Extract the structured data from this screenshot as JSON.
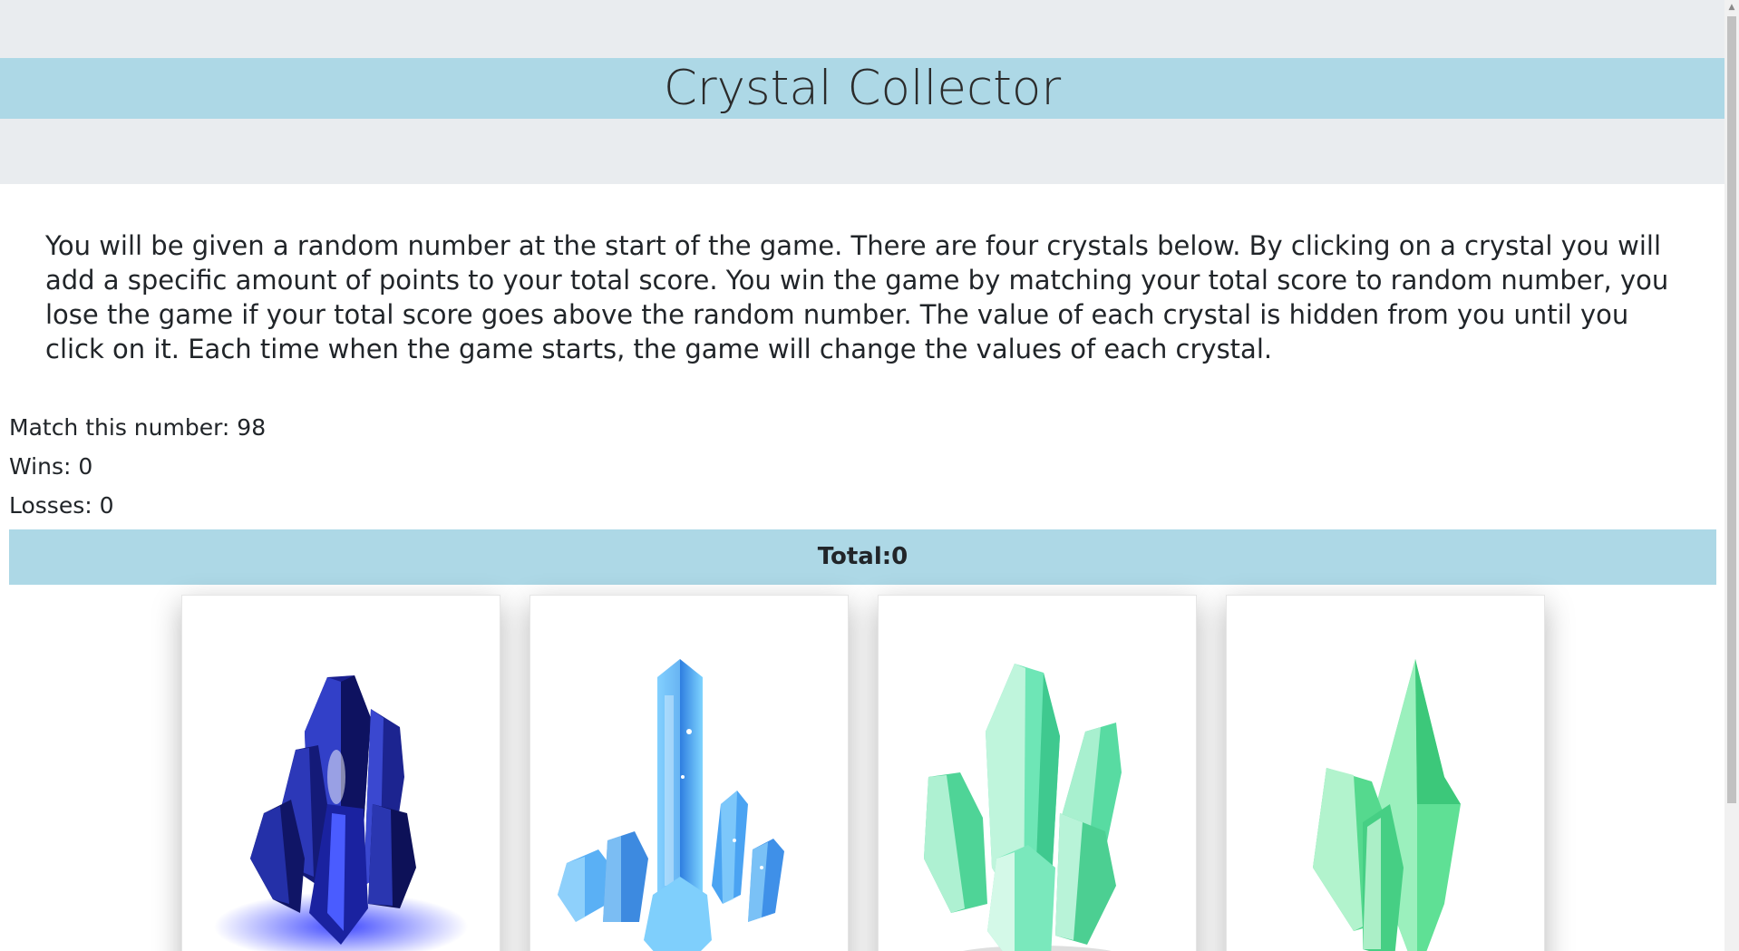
{
  "header": {
    "title": "Crystal Collector"
  },
  "instructions": {
    "text": "You will be given a random number at the start of the game. There are four crystals below. By clicking on a crystal you will add a specific amount of points to your total score. You win the game by matching your total score to random number, you lose the game if your total score goes above the random number. The value of each crystal is hidden from you until you click on it. Each time when the game starts, the game will change the values of each crystal."
  },
  "stats": {
    "target_label": "Match this number: 98",
    "wins_label": "Wins: 0",
    "losses_label": "Losses: 0"
  },
  "total": {
    "label": "Total:0"
  },
  "crystals": [
    {
      "name": "blue-sapphire-crystal",
      "color": "#1f2fa8"
    },
    {
      "name": "light-blue-crystal",
      "color": "#4a9ff0"
    },
    {
      "name": "mint-green-crystal-cluster",
      "color": "#5fe0a8"
    },
    {
      "name": "green-crystal-spike",
      "color": "#4fd88a"
    }
  ],
  "colors": {
    "header_bg": "#e9ecef",
    "accent_band": "#add8e6"
  }
}
